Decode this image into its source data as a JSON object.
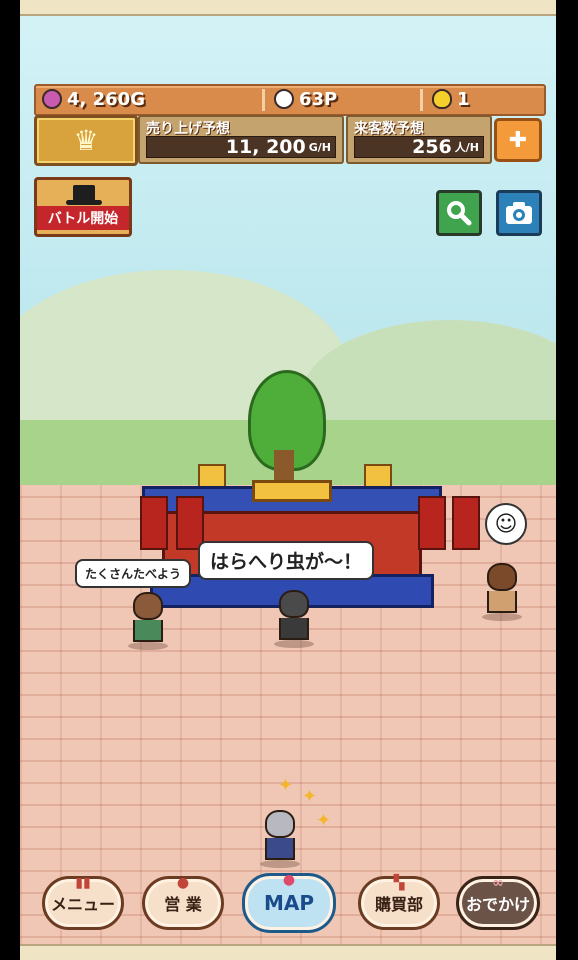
{
  "hud": {
    "gold": "4, 260G",
    "points": "63P",
    "eggs": "1",
    "crown_icon": "crown-icon",
    "sales_forecast": {
      "label": "売り上げ予想",
      "value": "11, 200",
      "unit": "G/H"
    },
    "visitor_forecast": {
      "label": "来客数予想",
      "value": "256",
      "unit": "人/H"
    },
    "add_egg_icon": "egg-plus-icon"
  },
  "buttons": {
    "battle_start": "バトル開始",
    "search_icon": "magnifier-icon",
    "camera_icon": "camera-icon"
  },
  "speech": {
    "main": "はらへり虫が～！",
    "side": "たくさんたべよう",
    "face": "☺"
  },
  "nav": {
    "menu": "メニュー",
    "business": "営 業",
    "map": "MAP",
    "purchasing": "購買部",
    "outing": "おでかけ"
  },
  "colors": {
    "hud_orange": "#d98b4c",
    "map_blue": "#1d5a8a",
    "brick": "#efc7b4"
  }
}
